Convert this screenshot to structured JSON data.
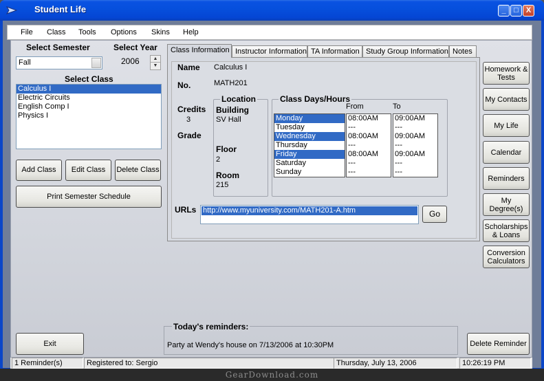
{
  "window": {
    "title": "Student Life",
    "min": "_",
    "max": "□",
    "close": "X"
  },
  "menu": [
    "File",
    "Class",
    "Tools",
    "Options",
    "Skins",
    "Help"
  ],
  "semester": {
    "label": "Select Semester",
    "value": "Fall"
  },
  "year": {
    "label": "Select Year",
    "value": "2006"
  },
  "classes": {
    "label": "Select Class",
    "items": [
      "Calculus I",
      "Electric Circuits",
      "English Comp I",
      "Physics I"
    ],
    "selected": 0
  },
  "class_buttons": {
    "add": "Add Class",
    "edit": "Edit Class",
    "delete": "Delete Class",
    "print": "Print Semester Schedule"
  },
  "tabs": [
    "Class Information",
    "Instructor Information",
    "TA Information",
    "Study Group Information",
    "Notes"
  ],
  "info": {
    "name_label": "Name",
    "name_value": "Calculus I",
    "no_label": "No.",
    "no_value": "MATH201",
    "credits_label": "Credits",
    "credits_value": "3",
    "grade_label": "Grade"
  },
  "location": {
    "title": "Location",
    "building_label": "Building",
    "building_value": "SV Hall",
    "floor_label": "Floor",
    "floor_value": "2",
    "room_label": "Room",
    "room_value": "215"
  },
  "schedule": {
    "title": "Class Days/Hours",
    "from_label": "From",
    "to_label": "To",
    "days": [
      {
        "day": "Monday",
        "from": "08:00AM",
        "to": "09:00AM",
        "sel": true
      },
      {
        "day": "Tuesday",
        "from": "---",
        "to": "---",
        "sel": false
      },
      {
        "day": "Wednesday",
        "from": "08:00AM",
        "to": "09:00AM",
        "sel": true
      },
      {
        "day": "Thursday",
        "from": "---",
        "to": "---",
        "sel": false
      },
      {
        "day": "Friday",
        "from": "08:00AM",
        "to": "09:00AM",
        "sel": true
      },
      {
        "day": "Saturday",
        "from": "---",
        "to": "---",
        "sel": false
      },
      {
        "day": "Sunday",
        "from": "---",
        "to": "---",
        "sel": false
      }
    ]
  },
  "urls": {
    "label": "URLs",
    "value": "http://www.myuniversity.com/MATH201-A.htm",
    "go": "Go"
  },
  "side_buttons": [
    "Homework & Tests",
    "My Contacts",
    "My Life",
    "Calendar",
    "Reminders",
    "My Degree(s)",
    "Scholarships & Loans",
    "Conversion Calculators"
  ],
  "reminders": {
    "title": "Today's reminders:",
    "text": "Party at Wendy's house on 7/13/2006 at 10:30PM",
    "delete": "Delete Reminder"
  },
  "exit": "Exit",
  "status": {
    "count": "1 Reminder(s)",
    "registered": "Registered to: Sergio",
    "date": "Thursday, July 13, 2006",
    "time": "10:26:19 PM"
  },
  "watermark": "GearDownload.com"
}
